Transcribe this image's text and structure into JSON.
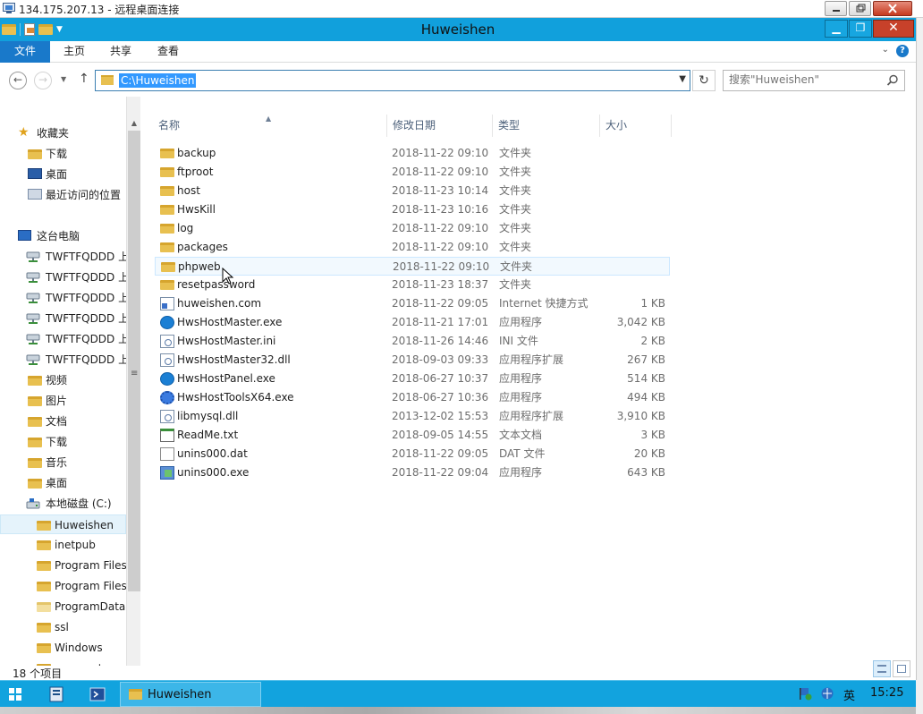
{
  "rdp": {
    "title": "134.175.207.13 - 远程桌面连接"
  },
  "window": {
    "title": "Huweishen"
  },
  "ribbon": {
    "tabs": [
      "文件",
      "主页",
      "共享",
      "查看"
    ]
  },
  "address": {
    "path": "C:\\Huweishen"
  },
  "search": {
    "placeholder": "搜索\"Huweishen\""
  },
  "nav": {
    "favorites": "收藏夹",
    "fav_items": [
      "下载",
      "桌面",
      "最近访问的位置"
    ],
    "this_pc": "这台电脑",
    "drives": [
      "TWFTFQDDD 上",
      "TWFTFQDDD 上",
      "TWFTFQDDD 上",
      "TWFTFQDDD 上",
      "TWFTFQDDD 上",
      "TWFTFQDDD 上"
    ],
    "libraries": [
      "视频",
      "图片",
      "文档",
      "下载",
      "音乐",
      "桌面"
    ],
    "local_disk": "本地磁盘 (C:)",
    "c_folders": [
      "Huweishen",
      "inetpub",
      "Program Files",
      "Program Files",
      "ProgramData",
      "ssl",
      "Windows",
      "wwwroot"
    ]
  },
  "columns": {
    "name": "名称",
    "date": "修改日期",
    "type": "类型",
    "size": "大小"
  },
  "files": [
    {
      "name": "backup",
      "date": "2018-11-22 09:10",
      "type": "文件夹",
      "size": "",
      "icon": "folder-icon"
    },
    {
      "name": "ftproot",
      "date": "2018-11-22 09:10",
      "type": "文件夹",
      "size": "",
      "icon": "folder-icon"
    },
    {
      "name": "host",
      "date": "2018-11-23 10:14",
      "type": "文件夹",
      "size": "",
      "icon": "folder-icon"
    },
    {
      "name": "HwsKill",
      "date": "2018-11-23 10:16",
      "type": "文件夹",
      "size": "",
      "icon": "folder-icon"
    },
    {
      "name": "log",
      "date": "2018-11-22 09:10",
      "type": "文件夹",
      "size": "",
      "icon": "folder-icon"
    },
    {
      "name": "packages",
      "date": "2018-11-22 09:10",
      "type": "文件夹",
      "size": "",
      "icon": "folder-icon"
    },
    {
      "name": "phpweb",
      "date": "2018-11-22 09:10",
      "type": "文件夹",
      "size": "",
      "icon": "folder-icon"
    },
    {
      "name": "resetpassword",
      "date": "2018-11-23 18:37",
      "type": "文件夹",
      "size": "",
      "icon": "folder-icon"
    },
    {
      "name": "huweishen.com",
      "date": "2018-11-22 09:05",
      "type": "Internet 快捷方式",
      "size": "1 KB",
      "icon": "shortcut-icon"
    },
    {
      "name": "HwsHostMaster.exe",
      "date": "2018-11-21 17:01",
      "type": "应用程序",
      "size": "3,042 KB",
      "icon": "app-icon"
    },
    {
      "name": "HwsHostMaster.ini",
      "date": "2018-11-26 14:46",
      "type": "INI 文件",
      "size": "2 KB",
      "icon": "ini-file-icon"
    },
    {
      "name": "HwsHostMaster32.dll",
      "date": "2018-09-03 09:33",
      "type": "应用程序扩展",
      "size": "267 KB",
      "icon": "dll-file-icon"
    },
    {
      "name": "HwsHostPanel.exe",
      "date": "2018-06-27 10:37",
      "type": "应用程序",
      "size": "514 KB",
      "icon": "app-icon"
    },
    {
      "name": "HwsHostToolsX64.exe",
      "date": "2018-06-27 10:36",
      "type": "应用程序",
      "size": "494 KB",
      "icon": "gear-icon"
    },
    {
      "name": "libmysql.dll",
      "date": "2013-12-02 15:53",
      "type": "应用程序扩展",
      "size": "3,910 KB",
      "icon": "dll-file-icon"
    },
    {
      "name": "ReadMe.txt",
      "date": "2018-09-05 14:55",
      "type": "文本文档",
      "size": "3 KB",
      "icon": "text-file-icon"
    },
    {
      "name": "unins000.dat",
      "date": "2018-11-22 09:05",
      "type": "DAT 文件",
      "size": "20 KB",
      "icon": "blank-file-icon"
    },
    {
      "name": "unins000.exe",
      "date": "2018-11-22 09:04",
      "type": "应用程序",
      "size": "643 KB",
      "icon": "installer-icon"
    }
  ],
  "status": {
    "count": "18 个项目"
  },
  "taskbar": {
    "task_label": "Huweishen",
    "ime": "英",
    "clock": "15:25"
  }
}
